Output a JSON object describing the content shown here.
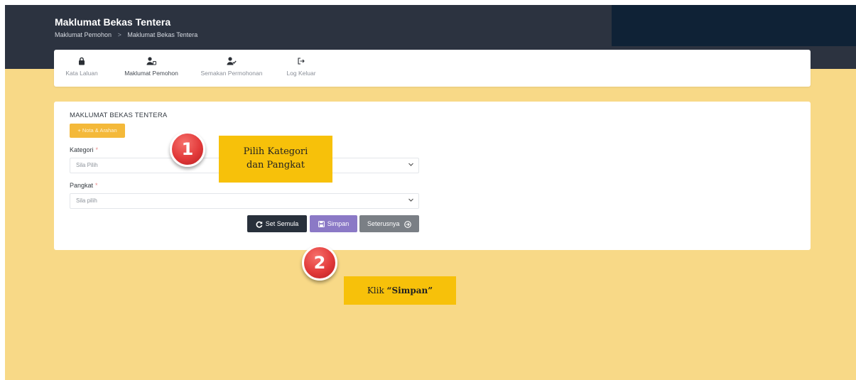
{
  "header": {
    "title": "Maklumat Bekas Tentera",
    "breadcrumb": [
      "Maklumat Pemohon",
      "Maklumat Bekas Tentera"
    ],
    "breadcrumb_separator": ">"
  },
  "nav": {
    "items": [
      {
        "label": "Kata Laluan",
        "icon": "lock-icon"
      },
      {
        "label": "Maklumat Pemohon",
        "icon": "user-id-icon",
        "active": true
      },
      {
        "label": "Semakan Permohonan",
        "icon": "user-check-icon"
      },
      {
        "label": "Log Keluar",
        "icon": "sign-out-icon"
      }
    ]
  },
  "form": {
    "section_title": "MAKLUMAT BEKAS TENTERA",
    "nota_button": "+ Nota & Arahan",
    "kategori": {
      "label": "Kategori",
      "required_mark": "*",
      "value": "Sila Pilih"
    },
    "pangkat": {
      "label": "Pangkat",
      "required_mark": "*",
      "value": "Sila pilih"
    },
    "buttons": {
      "reset": "Set Semula",
      "save": "Simpan",
      "next": "Seterusnya"
    }
  },
  "annotations": {
    "marker_1": "1",
    "callout_1_line1": "Pilih Kategori",
    "callout_1_line2": "dan Pangkat",
    "marker_2": "2",
    "callout_2_prefix": "Klik ",
    "callout_2_emphasis": "“Simpan”"
  },
  "colors": {
    "header_bg": "#2c3340",
    "page_bg": "#f8d987",
    "nota_button": "#f4b93a",
    "reset_button": "#28303b",
    "save_button": "#8b79c6",
    "next_button": "#7a7f85",
    "callout": "#f7c10a",
    "marker": "#e23a3a"
  }
}
